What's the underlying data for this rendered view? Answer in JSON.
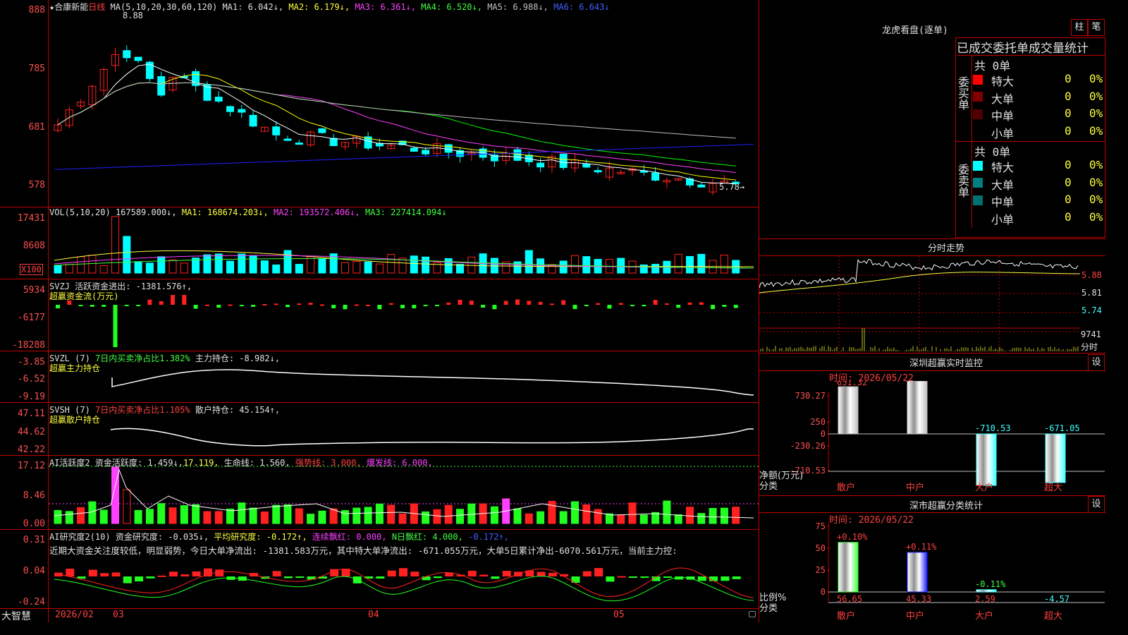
{
  "main_header": {
    "star": "★",
    "stock_name": "合康新能",
    "period": "日线",
    "ma_label": "MA(5,10,20,30,60,120)",
    "ma1": "MA1: 6.042↓,",
    "ma2": "MA2: 6.179↓,",
    "ma3": "MA3: 6.361↓,",
    "ma4": "MA4: 6.520↓,",
    "ma5": "MA5: 6.988↓,",
    "ma6": "MA6: 6.643↓",
    "high_mark": "8.88",
    "low_mark": "5.78→"
  },
  "price_axis": [
    "888",
    "785",
    "681",
    "578"
  ],
  "vol_header": {
    "name": "VOL(5,10,20)",
    "value": "167589.000↓,",
    "ma1": "MA1: 168674.203↓,",
    "ma2": "MA2: 193572.406↓,",
    "ma3": "MA3: 227414.094↓"
  },
  "vol_axis": [
    "17431",
    "8608",
    "X100"
  ],
  "svzj_header": {
    "name": "SVZJ",
    "label": "活跃资金进出: -1381.576↑,",
    "sub": "超赢资金流(万元)"
  },
  "svzj_axis": [
    "5934",
    "-6177",
    "-18288"
  ],
  "svzl_header": {
    "name": "SVZL (7)",
    "label": "7日内买卖净占比1.382%",
    "value": "主力持仓: -8.982↓,",
    "sub": "超赢主力持仓"
  },
  "svzl_axis": [
    "-3.85",
    "-6.52",
    "-9.19"
  ],
  "svsh_header": {
    "name": "SVSH (7)",
    "label": "7日内买卖净占比1.105%",
    "value": "散户持仓: 45.154↑,",
    "sub": "超赢散户持仓"
  },
  "svsh_axis": [
    "47.11",
    "44.62",
    "42.22"
  ],
  "ai_active_header": {
    "name": "AI活跃度2",
    "label": "资金活跃度: 1.459↓,",
    "v2": "17.119,",
    "life": "生命线: 1.560,",
    "strong": "强势线: 3.000,",
    "burst": "爆发线: 6.000,"
  },
  "ai_active_axis": [
    "17.12",
    "8.46",
    "0.00"
  ],
  "ai_research_header": {
    "name": "AI研究度2(10)",
    "label": "资金研究度: -0.035↓,",
    "avg": "平均研究度: -0.172↑,",
    "cont": "连续飘红: 0.000,",
    "nred": "N日飘红: 4.000,",
    "last": "-0.172↑,"
  },
  "ai_research_axis": [
    "0.31",
    "0.04",
    "-0.24"
  ],
  "ai_comment": "近期大资金关注度较低，明显弱势，今日大单净流出: -1381.583万元，其中特大单净流出: -671.055万元，大单5日累计净出-6070.561万元，当前主力控:",
  "bottom_axis": {
    "brand": "大智慧",
    "year": "2026/02",
    "m1": "03",
    "m2": "04",
    "m3": "05"
  },
  "right_top": {
    "title": "龙虎看盘(逐单)",
    "tab1": "柱",
    "tab2": "笔",
    "header": "已成交委托单成交量统计",
    "buy_label": "委买单",
    "sell_label": "委卖单",
    "buy_total": "共 0单",
    "sell_total": "共 0单",
    "buy_rows": [
      {
        "name": "特大",
        "count": "0",
        "pct": "0%",
        "color": "#ff0000"
      },
      {
        "name": "大单",
        "count": "0",
        "pct": "0%",
        "color": "#800000"
      },
      {
        "name": "中单",
        "count": "0",
        "pct": "0%",
        "color": "#500000"
      },
      {
        "name": "小单",
        "count": "0",
        "pct": "0%",
        "color": "#000000"
      }
    ],
    "sell_rows": [
      {
        "name": "特大",
        "count": "0",
        "pct": "0%",
        "color": "#00ffff"
      },
      {
        "name": "大单",
        "count": "0",
        "pct": "0%",
        "color": "#008080"
      },
      {
        "name": "中单",
        "count": "0",
        "pct": "0%",
        "color": "#007070"
      },
      {
        "name": "小单",
        "count": "0",
        "pct": "0%",
        "color": "#000000"
      }
    ]
  },
  "intraday": {
    "title": "分时走势",
    "axis": [
      "5.88",
      "5.81",
      "5.74"
    ],
    "vol_max": "9741",
    "vol_unit": "分时"
  },
  "sz_monitor": {
    "title": "深圳超赢实时监控",
    "btn": "设",
    "time": "时间: 2026/05/22",
    "axis": [
      "730.27",
      "250",
      "0",
      "-230.26",
      "-710.53"
    ],
    "ylabel": "净额(万元)",
    "xlabel": "分类",
    "cats": [
      "散户",
      "中户",
      "大户",
      "超大"
    ],
    "values": [
      651.32,
      730.27,
      -710.53,
      -671.05
    ],
    "value_labels": [
      "651.32",
      "730.27",
      "-710.53",
      "-671.05"
    ]
  },
  "sz_class": {
    "title": "深市超赢分类统计",
    "btn": "设",
    "time": "时间: 2026/05/22",
    "axis": [
      "75",
      "50",
      "25",
      "0"
    ],
    "ylabel": "比例%",
    "xlabel": "分类",
    "cats": [
      "散户",
      "中户",
      "大户",
      "超大"
    ],
    "values": [
      56.65,
      45.33,
      2.59,
      -4.57
    ],
    "value_labels": [
      "56.65",
      "45.33",
      "2.59",
      "-4.57"
    ],
    "changes": [
      "+0.10%",
      "+0.11%",
      "-0.11%",
      ""
    ]
  },
  "colors": {
    "up": "#ff2020",
    "down": "#00ffff",
    "frame": "#c00000",
    "ma1": "#ffffff",
    "ma2": "#ffff00",
    "ma3": "#ff40ff",
    "ma4": "#00ff00",
    "ma5": "#c0c0c0",
    "ma6": "#2020ff"
  }
}
